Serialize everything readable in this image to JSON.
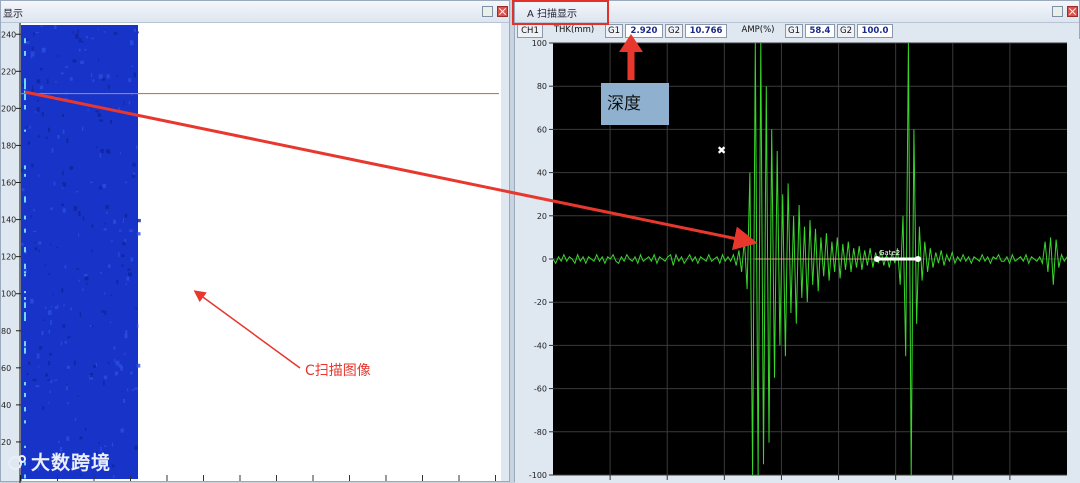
{
  "left_window": {
    "title": "显示",
    "c_scan_ticks": [
      "240",
      "220",
      "200",
      "180",
      "160",
      "140",
      "120",
      "100",
      "80",
      "60",
      "40",
      "20"
    ],
    "annotation_label": "C扫描图像",
    "watermark": "大数跨境"
  },
  "right_window": {
    "title": "A 扫描显示",
    "info_bar": {
      "channel": "CH1",
      "thk_label": "THK(mm)",
      "g1_label": "G1",
      "g1_value": "2.920",
      "g2_label": "G2",
      "g2_value": "10.766",
      "amp_label": "AMP(%)",
      "amp_g1_label": "G1",
      "amp_g1_value": "58.4",
      "amp_g2_label": "G2",
      "amp_g2_value": "100.0"
    },
    "depth_label": "深度",
    "gate_label": "Gate2"
  },
  "colors": {
    "plot_bg": "#000000",
    "waveform": "#39d62b",
    "c_scan": "#1833c8",
    "annotation_red": "#e8372d",
    "gate_line": "#ffffff",
    "cursor_line": "#c07860"
  },
  "chart_data": [
    {
      "type": "heatmap",
      "title": "",
      "ylabel": "",
      "ylim": [
        0,
        245
      ],
      "yticks": [
        240,
        220,
        200,
        180,
        160,
        140,
        120,
        100,
        80,
        60,
        40,
        20
      ],
      "cursor_y": 208,
      "grid": false
    },
    {
      "type": "line",
      "title": "",
      "ylabel": "",
      "ylim": [
        -100,
        100
      ],
      "yticks": [
        100,
        80,
        60,
        40,
        20,
        0,
        -20,
        -40,
        -60,
        -80,
        -100
      ],
      "grid": true,
      "series": [
        {
          "values": [
            0,
            -2,
            1,
            -1,
            2,
            -1,
            1,
            0,
            -2,
            2,
            -1,
            1,
            -2,
            1,
            0,
            -1,
            2,
            -1,
            1,
            -2,
            1,
            0,
            2,
            -1,
            -2,
            1,
            -1,
            2,
            0,
            -1,
            1,
            -2,
            2,
            -1,
            0,
            1,
            -1,
            2,
            -2,
            1,
            0,
            -1,
            1,
            2,
            -3,
            2,
            -1,
            1,
            -2,
            0,
            2,
            -1,
            1,
            -2,
            1,
            0,
            -1,
            2,
            -1,
            0,
            1,
            -2,
            2,
            -1,
            1,
            -1,
            2,
            -3,
            4,
            -6,
            9,
            -14,
            40,
            -100,
            100,
            -100,
            100,
            -95,
            80,
            -85,
            60,
            -55,
            50,
            -40,
            30,
            -45,
            35,
            -25,
            20,
            -30,
            25,
            -18,
            15,
            -20,
            18,
            -12,
            14,
            -15,
            10,
            -8,
            12,
            -10,
            8,
            -6,
            10,
            -9,
            7,
            -5,
            8,
            -6,
            5,
            -4,
            6,
            -5,
            4,
            -3,
            5,
            -4,
            3,
            -2,
            4,
            -3,
            2,
            -4,
            3,
            -2,
            5,
            -12,
            20,
            -45,
            100,
            -100,
            60,
            -30,
            15,
            -10,
            8,
            -6,
            5,
            -4,
            3,
            -2,
            4,
            -3,
            2,
            -1,
            3,
            -2,
            1,
            -1,
            2,
            -1,
            1,
            -2,
            1,
            0,
            -1,
            2,
            -1,
            1,
            -2,
            1,
            0,
            2,
            -1,
            -1,
            1,
            -2,
            2,
            -1,
            0,
            1,
            -1,
            2,
            -2,
            1,
            0,
            -1,
            1,
            -2,
            8,
            -6,
            10,
            -12,
            9,
            -4,
            2,
            -1,
            1
          ]
        }
      ]
    }
  ]
}
